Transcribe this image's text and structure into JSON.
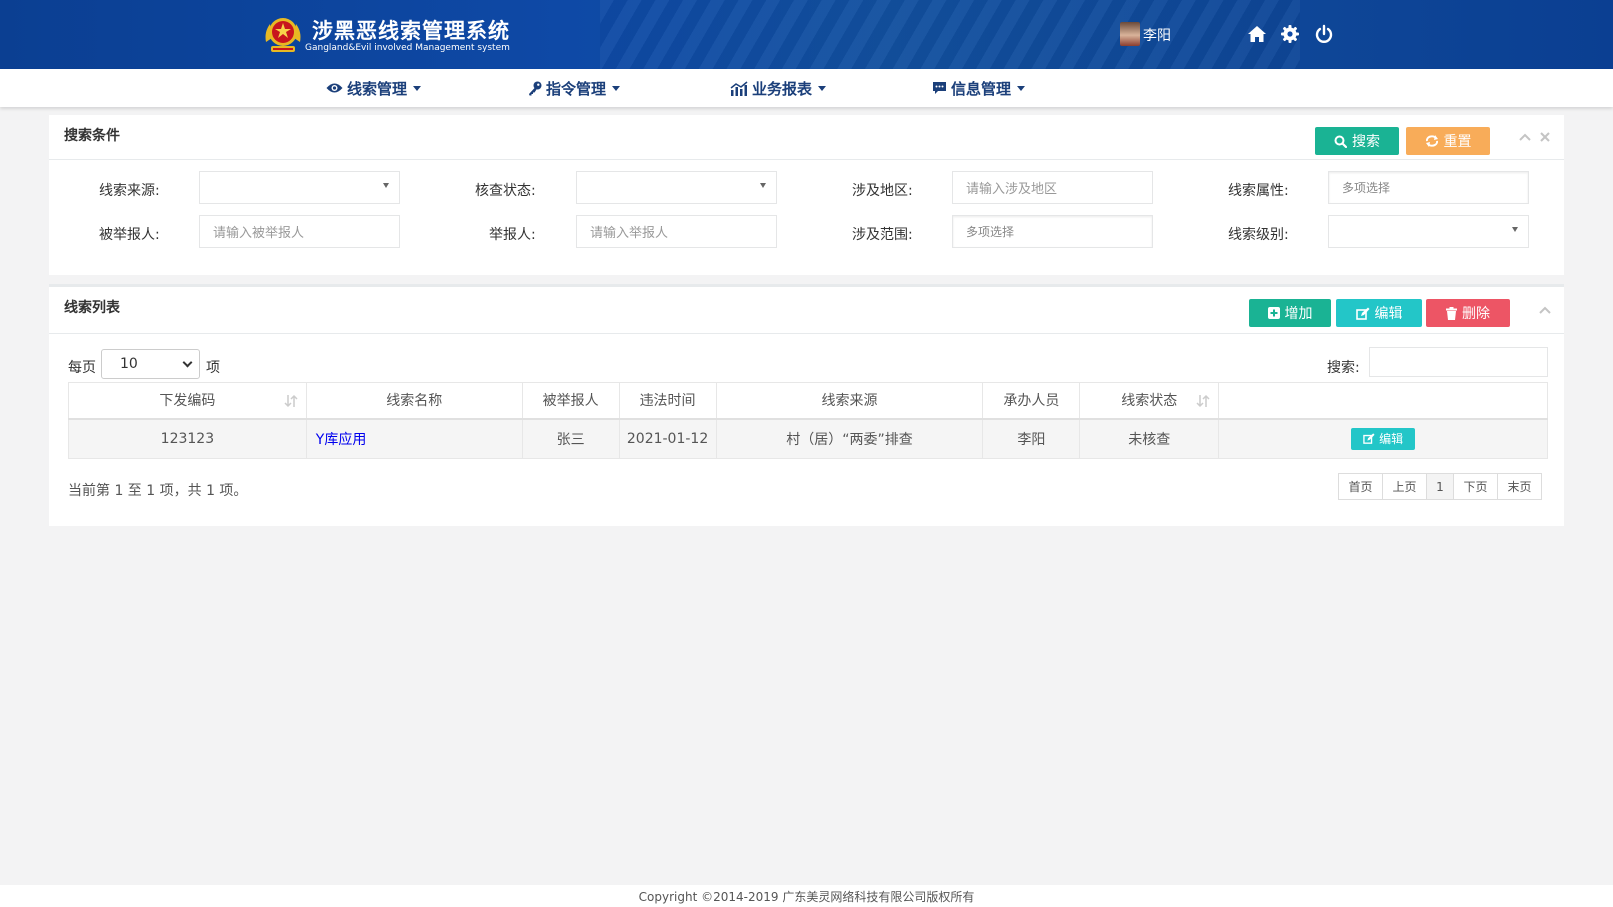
{
  "header": {
    "title": "涉黑恶线索管理系统",
    "subtitle": "Gangland&Evil involved Management system",
    "user_name": "李阳"
  },
  "nav": [
    {
      "label": "线索管理",
      "icon": "eye-icon"
    },
    {
      "label": "指令管理",
      "icon": "key-icon"
    },
    {
      "label": "业务报表",
      "icon": "bar-chart-icon"
    },
    {
      "label": "信息管理",
      "icon": "comment-icon"
    }
  ],
  "search_panel": {
    "title": "搜索条件",
    "search_label": "搜索",
    "reset_label": "重置",
    "fields": {
      "source": {
        "label": "线索来源:",
        "value": ""
      },
      "check_status": {
        "label": "核查状态:",
        "value": ""
      },
      "region": {
        "label": "涉及地区:",
        "placeholder": "请输入涉及地区"
      },
      "attribute": {
        "label": "线索属性:",
        "placeholder": "多项选择"
      },
      "reported": {
        "label": "被举报人:",
        "placeholder": "请输入被举报人"
      },
      "reporter": {
        "label": "举报人:",
        "placeholder": "请输入举报人"
      },
      "scope": {
        "label": "涉及范围:",
        "placeholder": "多项选择"
      },
      "level": {
        "label": "线索级别:",
        "value": ""
      }
    }
  },
  "list_panel": {
    "title": "线索列表",
    "add_label": "增加",
    "edit_label": "编辑",
    "delete_label": "删除",
    "per_page_prefix": "每页",
    "per_page_value": "10",
    "per_page_suffix": "项",
    "search_label": "搜索:",
    "columns": [
      "下发编码",
      "线索名称",
      "被举报人",
      "违法时间",
      "线索来源",
      "承办人员",
      "线索状态",
      ""
    ],
    "rows": [
      {
        "code": "123123",
        "name": "Y库应用",
        "reported": "张三",
        "time": "2021-01-12",
        "source": "村（居）“两委”排查",
        "handler": "李阳",
        "status": "未核查",
        "action": "编辑"
      }
    ],
    "info": "当前第 1 至 1 项，共 1 项。",
    "pager": [
      "首页",
      "上页",
      "1",
      "下页",
      "末页"
    ]
  },
  "footer": {
    "copyright": "Copyright  ©2014-2019 广东美灵网络科技有限公司版权所有"
  },
  "colors": {
    "header_blue": "#0b3f92",
    "green": "#1ab394",
    "orange": "#f8ac59",
    "cyan": "#23c6c8",
    "red": "#ed5565"
  }
}
